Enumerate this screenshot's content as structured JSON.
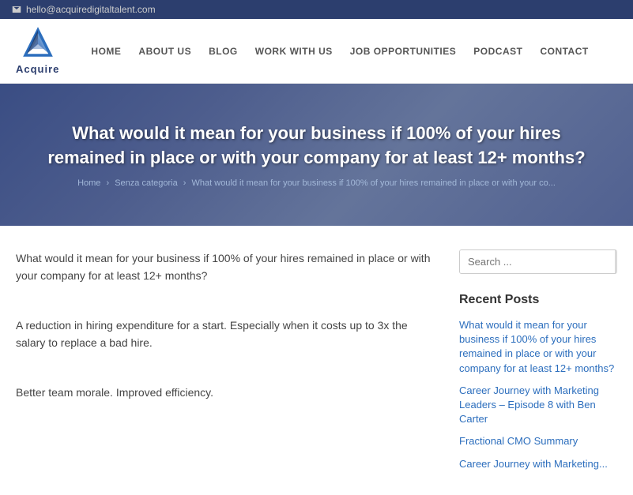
{
  "topbar": {
    "email": "hello@acquiredigitaltalent.com",
    "email_icon": "envelope-icon"
  },
  "header": {
    "logo_text": "Acquire",
    "nav_items": [
      {
        "label": "HOME",
        "id": "nav-home"
      },
      {
        "label": "ABOUT US",
        "id": "nav-about"
      },
      {
        "label": "BLOG",
        "id": "nav-blog"
      },
      {
        "label": "WORK WITH US",
        "id": "nav-work"
      },
      {
        "label": "JOB OPPORTUNITIES",
        "id": "nav-jobs"
      },
      {
        "label": "PODCAST",
        "id": "nav-podcast"
      },
      {
        "label": "CONTACT",
        "id": "nav-contact"
      }
    ]
  },
  "hero": {
    "title": "What would it mean for your business if 100% of your hires remained in place or with your company for at least 12+ months?",
    "breadcrumb_home": "Home",
    "breadcrumb_current": "Senza categoria",
    "breadcrumb_page": "What would it mean for your business if 100% of your hires remained in place or with your co..."
  },
  "content": {
    "para1": "What would it mean for your business if 100% of your hires remained in place or with your company for at least 12+ months?",
    "para2": "A reduction in hiring expenditure for a start. Especially when it costs up to 3x the salary to replace a bad hire.",
    "para3": "Better team morale. Improved efficiency."
  },
  "sidebar": {
    "search_placeholder": "Search ...",
    "search_btn_label": "🔍",
    "recent_posts_title": "Recent Posts",
    "recent_posts": [
      {
        "label": "What would it mean for your business if 100% of your hires remained in place or with your company for at least 12+ months?"
      },
      {
        "label": "Career Journey with Marketing Leaders – Episode 8 with Ben Carter"
      },
      {
        "label": "Fractional CMO Summary"
      },
      {
        "label": "Career Journey with Marketing..."
      }
    ]
  }
}
